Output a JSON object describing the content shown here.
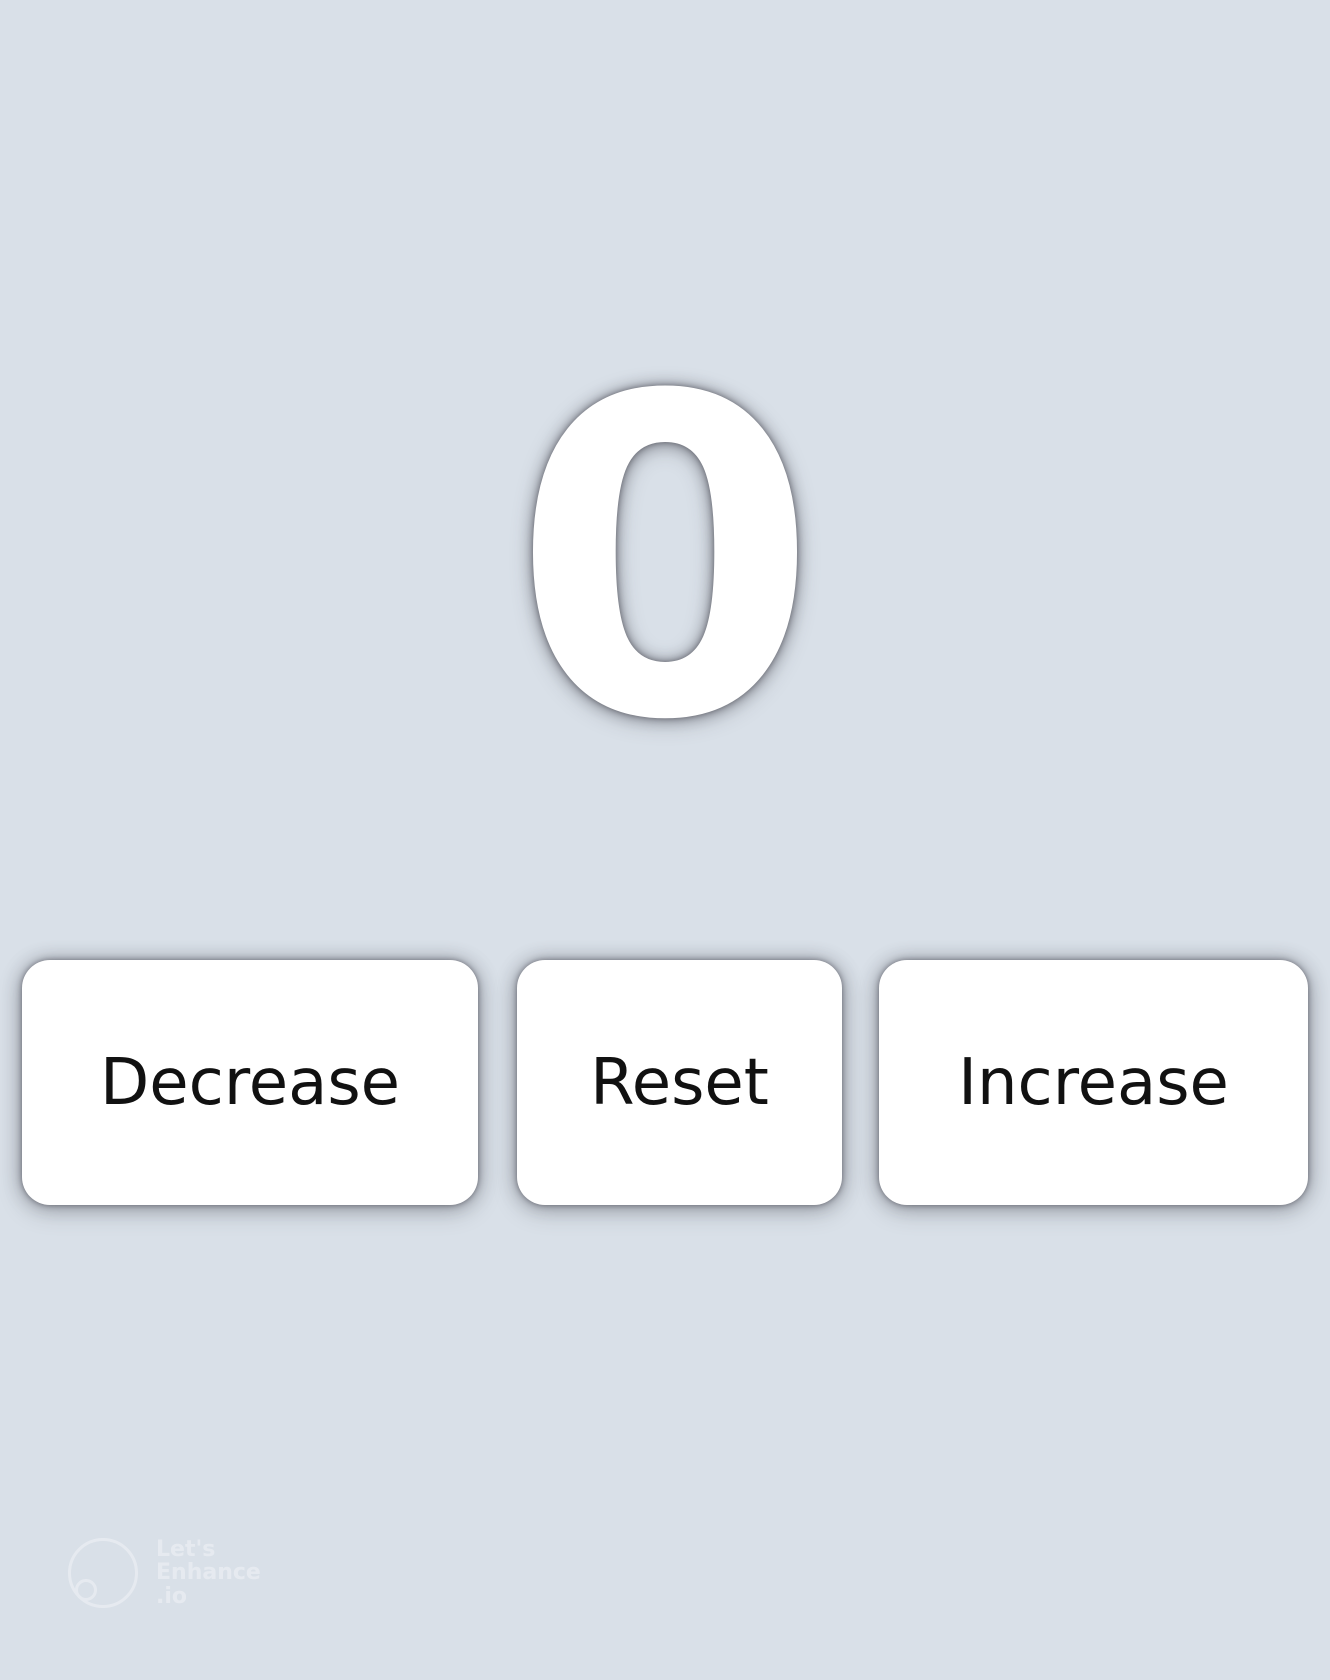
{
  "counter": {
    "value": "0"
  },
  "buttons": {
    "decrease_label": "Decrease",
    "reset_label": "Reset",
    "increase_label": "Increase"
  },
  "watermark": {
    "line1": "Let's",
    "line2": "Enhance",
    "line3": ".io"
  },
  "colors": {
    "background": "#d9e0e8",
    "button_bg": "#ffffff",
    "text": "#111111",
    "counter_text": "#ffffff"
  }
}
